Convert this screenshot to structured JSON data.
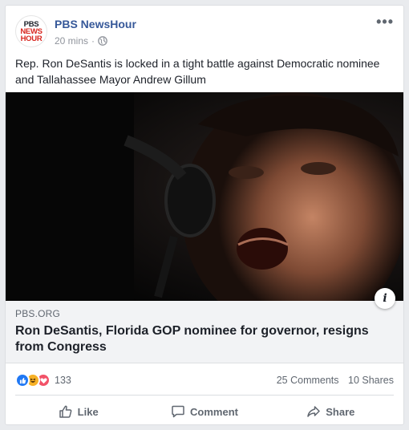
{
  "post": {
    "page_name": "PBS NewsHour",
    "avatar_lines": [
      "PBS",
      "NEWS",
      "HOUR"
    ],
    "time": "20 mins",
    "dot": "·",
    "more_label": "•••",
    "text": "Rep. Ron DeSantis is locked in a tight battle against Democratic nominee and Tallahassee Mayor Andrew Gillum"
  },
  "link": {
    "domain": "PBS.ORG",
    "title": "Ron DeSantis, Florida GOP nominee for governor, resigns from Congress",
    "info_label": "i"
  },
  "stats": {
    "reaction_count": "133",
    "reaction_icons": [
      "like-icon",
      "haha-icon",
      "love-icon"
    ],
    "comments": "25 Comments",
    "shares": "10 Shares"
  },
  "actions": {
    "like": "Like",
    "comment": "Comment",
    "share": "Share"
  },
  "colors": {
    "link_blue": "#365899",
    "like_blue": "#2078f4",
    "haha_yellow": "#f7b125",
    "love_red": "#f25268",
    "secondary_text": "#606770"
  }
}
